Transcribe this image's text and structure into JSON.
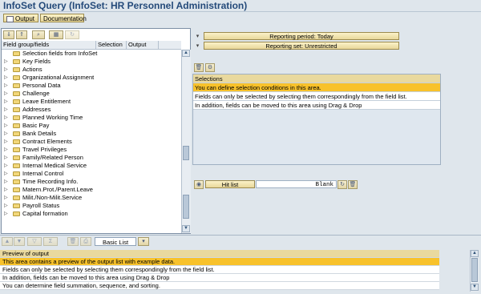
{
  "title": "InfoSet Query (InfoSet: HR Personnel Administration)",
  "toolbar": {
    "output_label": "Output",
    "documentation_label": "Documentation"
  },
  "tree": {
    "columns": {
      "field": "Field group/fields",
      "selection": "Selection",
      "output": "Output"
    },
    "items": [
      {
        "label": "Selection fields from InfoSet",
        "expandable": false
      },
      {
        "label": "Key Fields",
        "expandable": true
      },
      {
        "label": "Actions",
        "expandable": true
      },
      {
        "label": "Organizational Assignment",
        "expandable": true
      },
      {
        "label": "Personal Data",
        "expandable": true
      },
      {
        "label": "Challenge",
        "expandable": true
      },
      {
        "label": "Leave Entitlement",
        "expandable": true
      },
      {
        "label": "Addresses",
        "expandable": true
      },
      {
        "label": "Planned Working Time",
        "expandable": true
      },
      {
        "label": "Basic Pay",
        "expandable": true
      },
      {
        "label": "Bank Details",
        "expandable": true
      },
      {
        "label": "Contract Elements",
        "expandable": true
      },
      {
        "label": "Travel Privileges",
        "expandable": true
      },
      {
        "label": "Family/Related Person",
        "expandable": true
      },
      {
        "label": "Internal Medical Service",
        "expandable": true
      },
      {
        "label": "Internal Control",
        "expandable": true
      },
      {
        "label": "Time Recording Info.",
        "expandable": true
      },
      {
        "label": "Matern.Prot./Parent.Leave",
        "expandable": true
      },
      {
        "label": "Milit./Non-Milit.Service",
        "expandable": true
      },
      {
        "label": "Payroll Status",
        "expandable": true
      },
      {
        "label": "Capital formation",
        "expandable": true
      }
    ]
  },
  "reporting": {
    "period": "Reporting period: Today",
    "set": "Reporting set: Unrestricted"
  },
  "selections": {
    "header": "Selections",
    "lines": [
      "You can define selection conditions in this area.",
      "Fields can only be selected by selecting them correspondingly from the field list.",
      "In addition, fields can be moved to this area using Drag & Drop"
    ]
  },
  "hitlist": {
    "label": "Hit list",
    "value": "Blank"
  },
  "preview_toolbar": {
    "list_type": "Basic List"
  },
  "preview": {
    "header": "Preview of output",
    "lines": [
      "This area contains a preview of the output list with example data.",
      "Fields can only be selected by selecting them correspondingly from the field list.",
      "In addition, fields can be moved to this area using Drag & Drop",
      "You can determine field summation, sequence, and sorting."
    ]
  },
  "colors": {
    "highlight": "#f8c22b",
    "title": "#244a7a",
    "panel_bg": "#dfe6ec"
  }
}
